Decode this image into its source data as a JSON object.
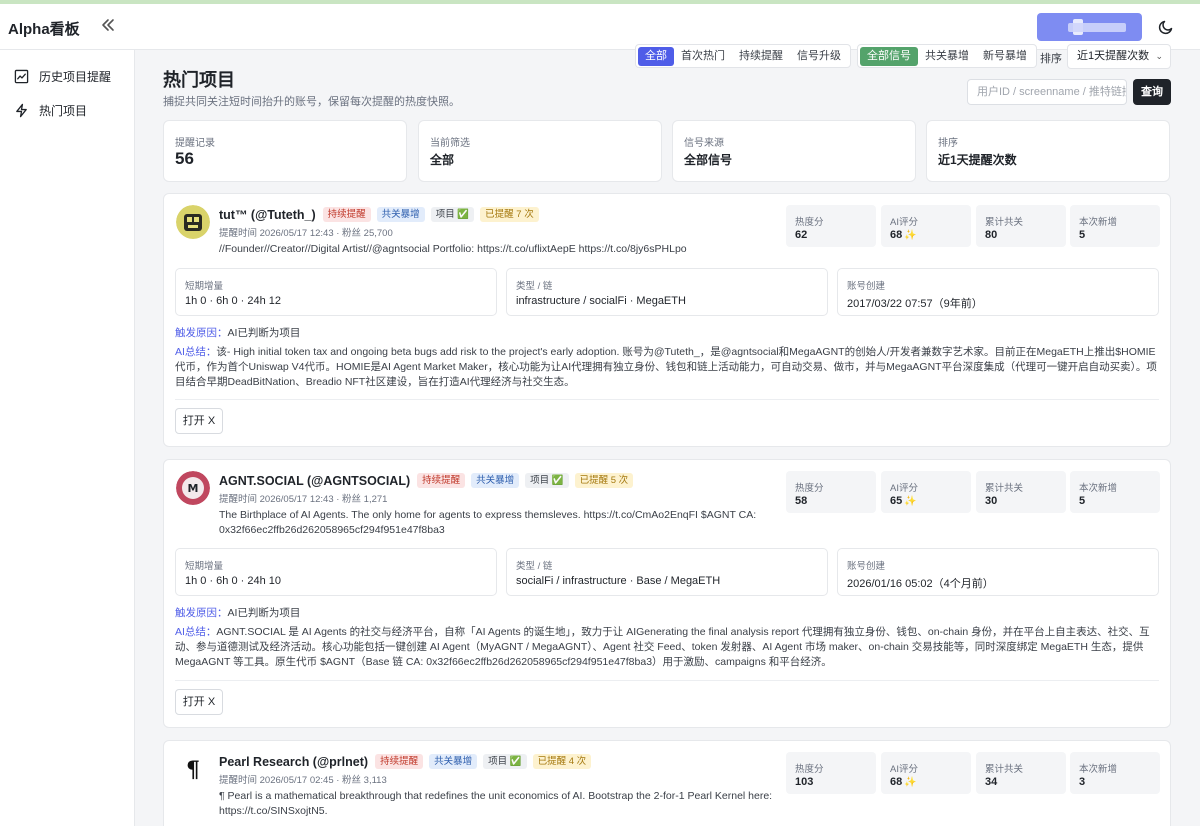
{
  "app": {
    "title": "Alpha看板",
    "user_label": "",
    "colors": {
      "accent": "#4f5de8",
      "signal": "#54a36b"
    }
  },
  "sidebar": {
    "items": [
      {
        "label": "历史项目提醒",
        "icon": "history-chart-icon"
      },
      {
        "label": "热门项目",
        "icon": "lightning-icon"
      }
    ]
  },
  "page": {
    "title": "热门项目",
    "subtitle": "捕捉共同关注短时间抬升的账号，保留每次提醒的热度快照。"
  },
  "filters": {
    "type_tabs": [
      "全部",
      "首次热门",
      "持续提醒",
      "信号升级"
    ],
    "type_selected": "全部",
    "signal_tabs": [
      "全部信号",
      "共关暴增",
      "新号暴增"
    ],
    "signal_selected": "全部信号",
    "sort_label": "排序",
    "sort_value": "近1天提醒次数",
    "search_placeholder": "用户ID / screenname / 推特链接",
    "query_label": "查询"
  },
  "stats": [
    {
      "label": "提醒记录",
      "value": "56"
    },
    {
      "label": "当前筛选",
      "value": "全部"
    },
    {
      "label": "信号来源",
      "value": "全部信号"
    },
    {
      "label": "排序",
      "value": "近1天提醒次数"
    }
  ],
  "labels": {
    "reason": "触发原因：",
    "summary": "AI总结：",
    "open": "打开 X"
  },
  "cards": [
    {
      "name": "tut™ (@Tuteth_)",
      "tags": [
        "持续提醒",
        "共关暴增",
        "项目 ✅",
        "已提醒 7 次"
      ],
      "meta": "提醒时间 2026/05/17 12:43 · 粉丝 25,700",
      "bio": "//Founder//Creator//Digital Artist//@agntsocial Portfolio: https://t.co/uflixtAepE https://t.co/8jy6sPHLpo",
      "metrics": [
        {
          "label": "热度分",
          "value": "62"
        },
        {
          "label": "AI评分",
          "value": "68"
        },
        {
          "label": "累计共关",
          "value": "80"
        },
        {
          "label": "本次新增",
          "value": "5"
        }
      ],
      "info": [
        {
          "label": "短期增量",
          "value": "1h 0 · 6h 0 · 24h 12"
        },
        {
          "label": "类型 / 链",
          "value": "infrastructure / socialFi · MegaETH"
        },
        {
          "label": "账号创建",
          "value": "2017/03/22 07:57（9年前）"
        }
      ],
      "reason": "AI已判断为项目",
      "summary": "该- High initial token tax and ongoing beta bugs add risk to the project's early adoption. 账号为@Tuteth_，是@agntsocial和MegaAGNT的创始人/开发者兼数字艺术家。目前正在MegaETH上推出$HOMIE代币，作为首个Uniswap V4代币。HOMIE是AI Agent Market Maker，核心功能为让AI代理拥有独立身份、钱包和链上活动能力，可自动交易、做市，并与MegaAGNT平台深度集成（代理可一键开启自动买卖）。项目结合早期DeadBitNation、Breadio NFT社区建设，旨在打造AI代理经济与社交生态。"
    },
    {
      "name": "AGNT.SOCIAL (@AGNTSOCIAL)",
      "tags": [
        "持续提醒",
        "共关暴增",
        "项目 ✅",
        "已提醒 5 次"
      ],
      "meta": "提醒时间 2026/05/17 12:43 · 粉丝 1,271",
      "bio": "The Birthplace of AI Agents. The only home for agents to express themsleves. https://t.co/CmAo2EnqFI $AGNT CA: 0x32f66ec2ffb26d262058965cf294f951e47f8ba3",
      "metrics": [
        {
          "label": "热度分",
          "value": "58"
        },
        {
          "label": "AI评分",
          "value": "65"
        },
        {
          "label": "累计共关",
          "value": "30"
        },
        {
          "label": "本次新增",
          "value": "5"
        }
      ],
      "info": [
        {
          "label": "短期增量",
          "value": "1h 0 · 6h 0 · 24h 10"
        },
        {
          "label": "类型 / 链",
          "value": "socialFi / infrastructure · Base / MegaETH"
        },
        {
          "label": "账号创建",
          "value": "2026/01/16 05:02（4个月前）"
        }
      ],
      "reason": "AI已判断为项目",
      "summary": "AGNT.SOCIAL 是 AI Agents 的社交与经济平台，自称「AI Agents 的诞生地」，致力于让 AIGenerating the final analysis report 代理拥有独立身份、钱包、on-chain 身份，并在平台上自主表达、社交、互动、参与道德测试及经济活动。核心功能包括一键创建 AI Agent（MyAGNT / MegaAGNT）、Agent 社交 Feed、token 发射器、AI Agent 市场 maker、on-chain 交易技能等，同时深度绑定 MegaETH 生态，提供 MegaAGNT 等工具。原生代币 $AGNT（Base 链 CA: 0x32f66ec2ffb26d262058965cf294f951e47f8ba3）用于激励、campaigns 和平台经济。"
    },
    {
      "name": "Pearl Research (@prlnet)",
      "tags": [
        "持续提醒",
        "共关暴增",
        "项目 ✅",
        "已提醒 4 次"
      ],
      "meta": "提醒时间 2026/05/17 02:45 · 粉丝 3,113",
      "bio": "¶ Pearl is a mathematical breakthrough that redefines the unit economics of AI. Bootstrap the 2-for-1 Pearl Kernel here: https://t.co/SINSxojtN5.",
      "metrics": [
        {
          "label": "热度分",
          "value": "103"
        },
        {
          "label": "AI评分",
          "value": "68"
        },
        {
          "label": "累计共关",
          "value": "34"
        },
        {
          "label": "本次新增",
          "value": "3"
        }
      ]
    }
  ]
}
